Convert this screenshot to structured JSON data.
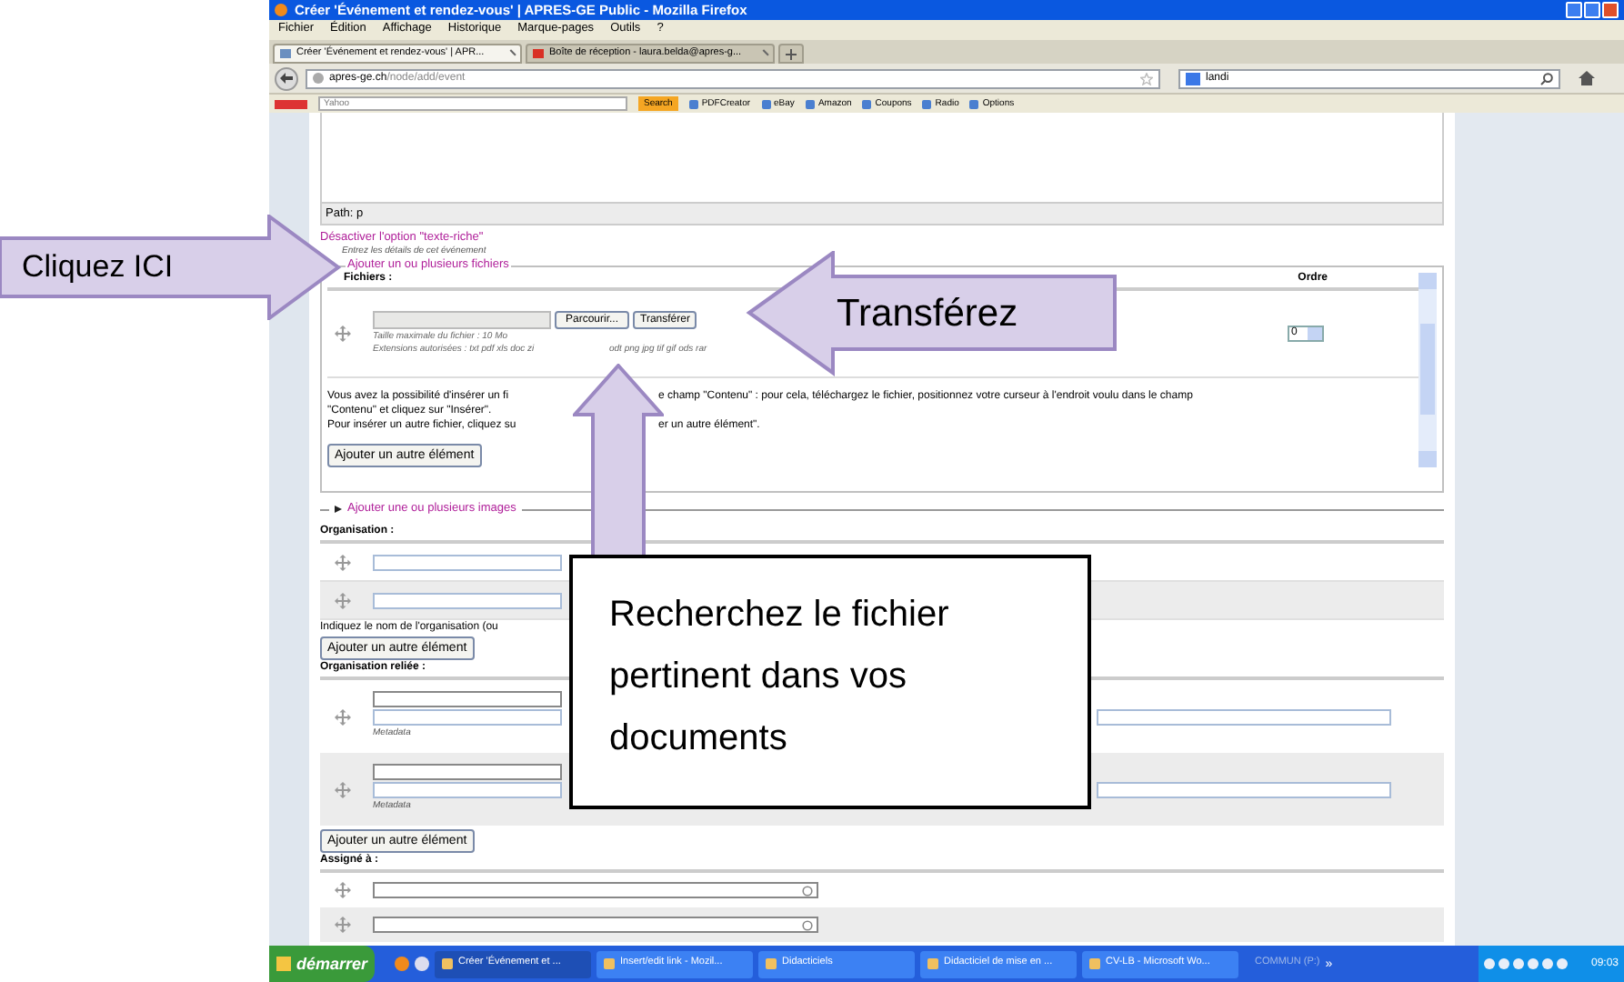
{
  "window": {
    "title": "Créer 'Événement et rendez-vous' | APRES-GE Public - Mozilla Firefox"
  },
  "menu": [
    "Fichier",
    "Édition",
    "Affichage",
    "Historique",
    "Marque-pages",
    "Outils",
    "?"
  ],
  "tabs": [
    {
      "label": "Créer 'Événement et rendez-vous' | APR...",
      "selected": true
    },
    {
      "label": "Boîte de réception - laura.belda@apres-g...",
      "selected": false
    }
  ],
  "address": {
    "host": "apres-ge.ch",
    "path": "/node/add/event"
  },
  "web_search": {
    "value": "landi"
  },
  "toolbar": {
    "search_field": "Yahoo",
    "search_button": "Search",
    "items": [
      "PDFCreator",
      "eBay",
      "Amazon",
      "Coupons",
      "Radio",
      "Options"
    ]
  },
  "editor": {
    "path": "Path: p"
  },
  "rich_text_link": "Désactiver l'option \"texte-riche\"",
  "details_hint": "Entrez les détails de cet événement",
  "files": {
    "legend": "Ajouter un ou plusieurs fichiers",
    "column_files": "Fichiers :",
    "column_order": "Ordre",
    "browse_button": "Parcourir...",
    "upload_button": "Transférer",
    "max_size": "Taille maximale du fichier : 10 Mo",
    "extensions": [
      "Extensions autorisées : txt pdf xls doc zi",
      "odt png jpg tif gif ods rar"
    ],
    "order": "0",
    "help_line_1": [
      "Vous avez la possibilité d'insérer un fi",
      "e champ \"Contenu\" : pour cela, téléchargez le fichier, positionnez votre curseur à l'endroit voulu dans le champ"
    ],
    "help_line_2": "\"Contenu\" et cliquez sur \"Insérer\".",
    "help_line_3": [
      "Pour insérer un autre fichier, cliquez su",
      "er un autre élément\"."
    ],
    "add_button": "Ajouter un autre élément"
  },
  "images": {
    "legend": "Ajouter une ou plusieurs images",
    "collapsed": true
  },
  "organisation": {
    "label": "Organisation :",
    "rows": [
      {
        "kind": "text"
      },
      {
        "kind": "text"
      }
    ],
    "hint": "Indiquez le nom de l'organisation (ou",
    "add_button": "Ajouter un autre élément"
  },
  "related_organisation": {
    "label": "Organisation reliée :",
    "rows": [
      {
        "kind": "reference",
        "note": "Metadata"
      },
      {
        "kind": "reference",
        "note": "Metadata"
      }
    ],
    "add_button": "Ajouter un autre élément"
  },
  "assigned": {
    "label": "Assigné à :",
    "rows": [
      {
        "kind": "autocomplete"
      },
      {
        "kind": "autocomplete"
      }
    ]
  },
  "taskbar": {
    "start": "démarrer",
    "tasks": [
      {
        "label": "Créer 'Événement et ...",
        "selected": true
      },
      {
        "label": "Insert/edit link - Mozil...",
        "selected": false
      },
      {
        "label": "Didacticiels",
        "selected": false
      },
      {
        "label": "Didacticiel de mise en ...",
        "selected": false
      },
      {
        "label": "CV-LB - Microsoft Wo...",
        "selected": false
      }
    ],
    "drive": "COMMUN (P:)",
    "more": "»",
    "clock": "09:03"
  },
  "callouts": [
    {
      "kind": "arrow_right",
      "text": "Cliquez ICI"
    },
    {
      "kind": "arrow_left",
      "text": "Transférez"
    },
    {
      "kind": "arrow_up"
    },
    {
      "kind": "box",
      "text": "Recherchez le fichier pertinent dans vos documents"
    }
  ]
}
